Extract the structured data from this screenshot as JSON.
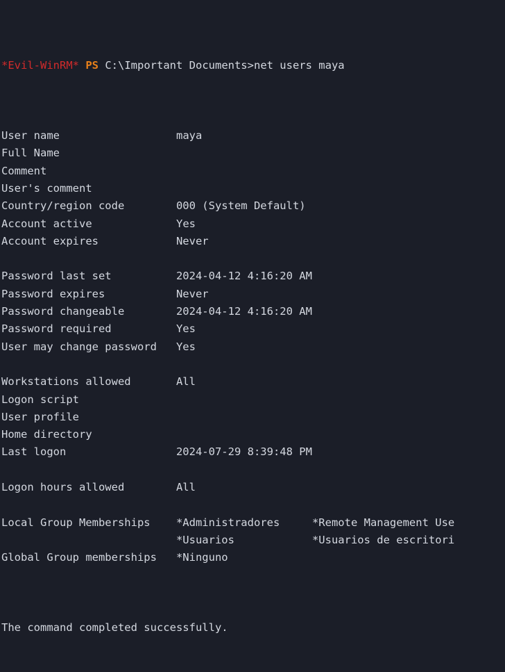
{
  "terminal": {
    "background_color": "#1b1e28",
    "foreground_color": "#d4d8e0",
    "columns": {
      "label_col": 0,
      "value_col": 27,
      "value_col2": 48
    },
    "prompt": {
      "shell_tag": "*Evil-WinRM*",
      "shell_tag_color": "#d22b2b",
      "ps_marker": "PS",
      "ps_marker_color": "#e8801a",
      "path": "C:\\Important Documents>",
      "command": "net users maya"
    },
    "rows": [
      {
        "label": "User name",
        "value": "maya"
      },
      {
        "label": "Full Name",
        "value": ""
      },
      {
        "label": "Comment",
        "value": ""
      },
      {
        "label": "User's comment",
        "value": ""
      },
      {
        "label": "Country/region code",
        "value": "000 (System Default)"
      },
      {
        "label": "Account active",
        "value": "Yes"
      },
      {
        "label": "Account expires",
        "value": "Never"
      },
      {
        "label": "",
        "value": ""
      },
      {
        "label": "Password last set",
        "value": "2024-04-12 4:16:20 AM"
      },
      {
        "label": "Password expires",
        "value": "Never"
      },
      {
        "label": "Password changeable",
        "value": "2024-04-12 4:16:20 AM"
      },
      {
        "label": "Password required",
        "value": "Yes"
      },
      {
        "label": "User may change password",
        "value": "Yes"
      },
      {
        "label": "",
        "value": ""
      },
      {
        "label": "Workstations allowed",
        "value": "All"
      },
      {
        "label": "Logon script",
        "value": ""
      },
      {
        "label": "User profile",
        "value": ""
      },
      {
        "label": "Home directory",
        "value": ""
      },
      {
        "label": "Last logon",
        "value": "2024-07-29 8:39:48 PM"
      },
      {
        "label": "",
        "value": ""
      },
      {
        "label": "Logon hours allowed",
        "value": "All"
      },
      {
        "label": "",
        "value": ""
      },
      {
        "label": "Local Group Memberships",
        "value": "*Administradores",
        "value2": "*Remote Management Use"
      },
      {
        "label": "",
        "value": "*Usuarios",
        "value2": "*Usuarios de escritori"
      },
      {
        "label": "Global Group memberships",
        "value": "*Ninguno"
      }
    ],
    "status_line": "The command completed successfully."
  }
}
